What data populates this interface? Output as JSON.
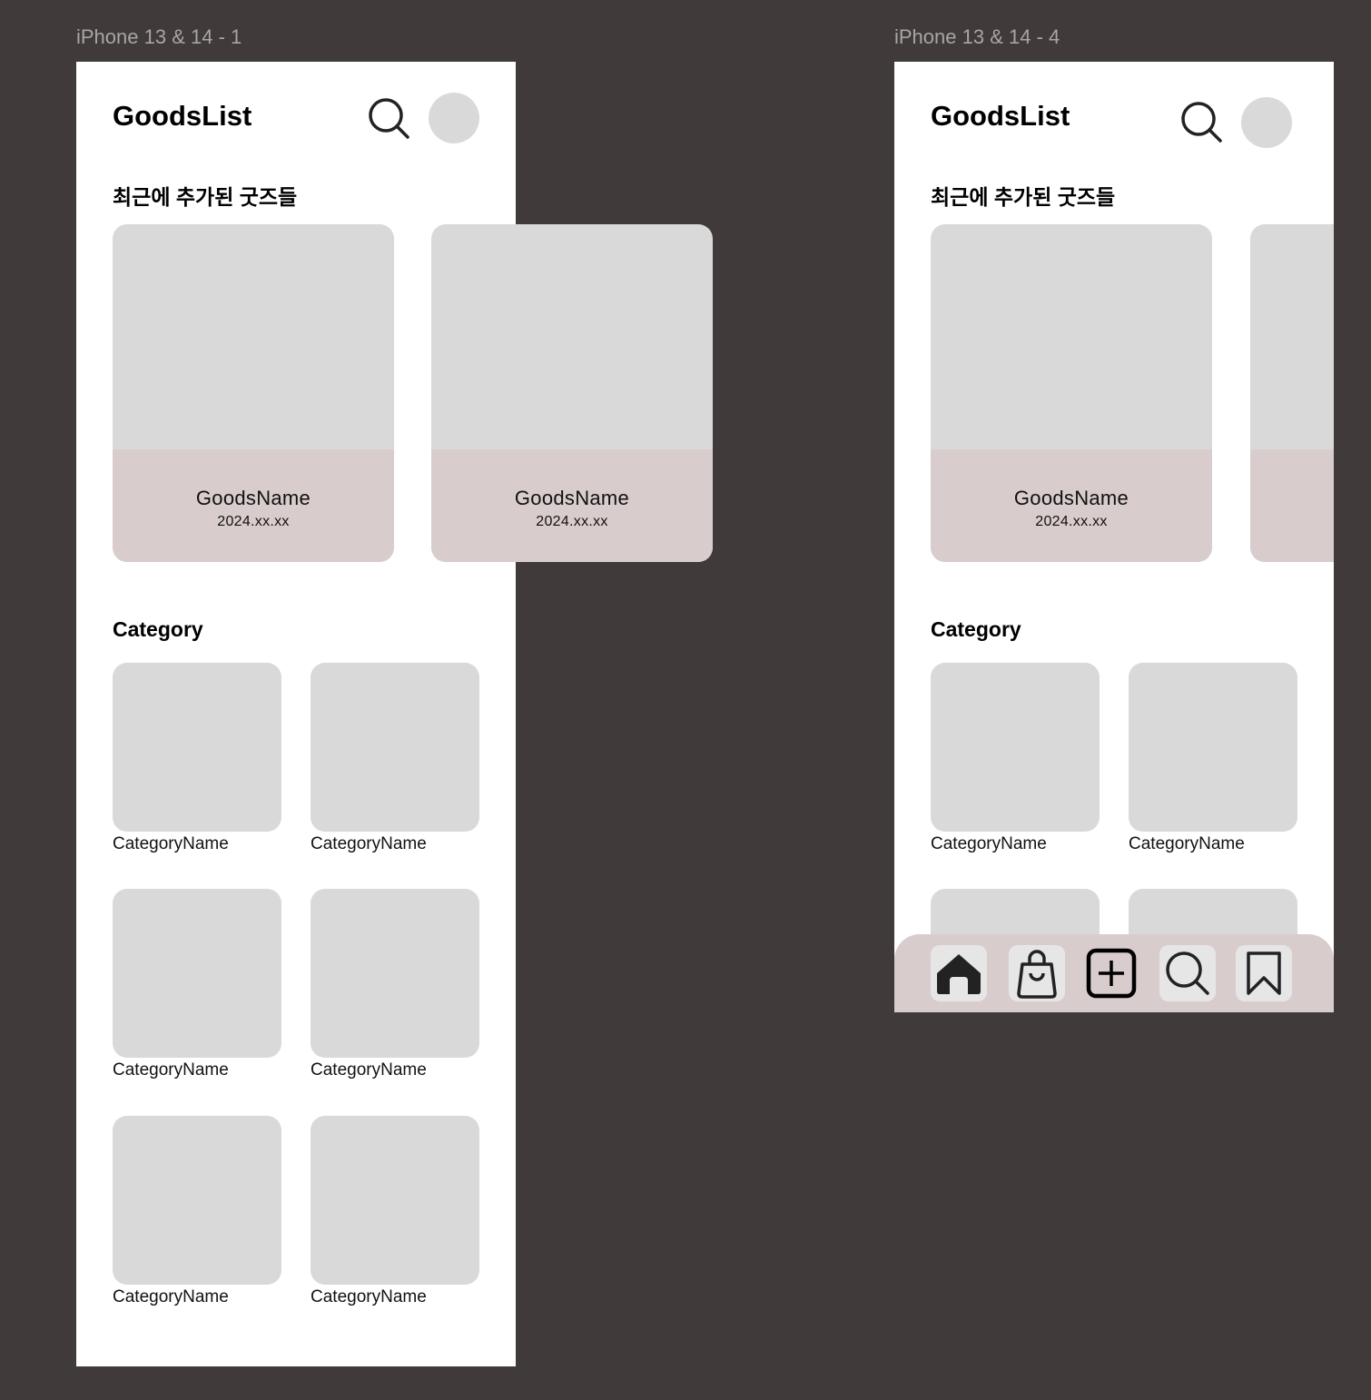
{
  "frames": [
    {
      "label": "iPhone 13 & 14 - 1",
      "app_title": "GoodsList",
      "recent_title": "최근에 추가된 굿즈들",
      "goods": [
        {
          "name": "GoodsName",
          "date": "2024.xx.xx"
        },
        {
          "name": "GoodsName",
          "date": "2024.xx.xx"
        }
      ],
      "category_title": "Category",
      "categories": [
        {
          "name": "CategoryName"
        },
        {
          "name": "CategoryName"
        },
        {
          "name": "CategoryName"
        },
        {
          "name": "CategoryName"
        },
        {
          "name": "CategoryName"
        },
        {
          "name": "CategoryName"
        }
      ]
    },
    {
      "label": "iPhone 13 & 14 - 4",
      "app_title": "GoodsList",
      "recent_title": "최근에 추가된 굿즈들",
      "goods": [
        {
          "name": "GoodsName",
          "date": "2024.xx.xx"
        }
      ],
      "category_title": "Category",
      "categories": [
        {
          "name": "CategoryName"
        },
        {
          "name": "CategoryName"
        }
      ],
      "bottom_nav": [
        "home-icon",
        "shopping-bag-icon",
        "add-square-icon",
        "search-icon",
        "bookmark-icon"
      ]
    }
  ],
  "colors": {
    "canvas": "#403a3b",
    "frame": "#ffffff",
    "placeholder": "#d9d9d9",
    "card_info": "#d9cccc",
    "nav_bar": "#d9cccc"
  }
}
